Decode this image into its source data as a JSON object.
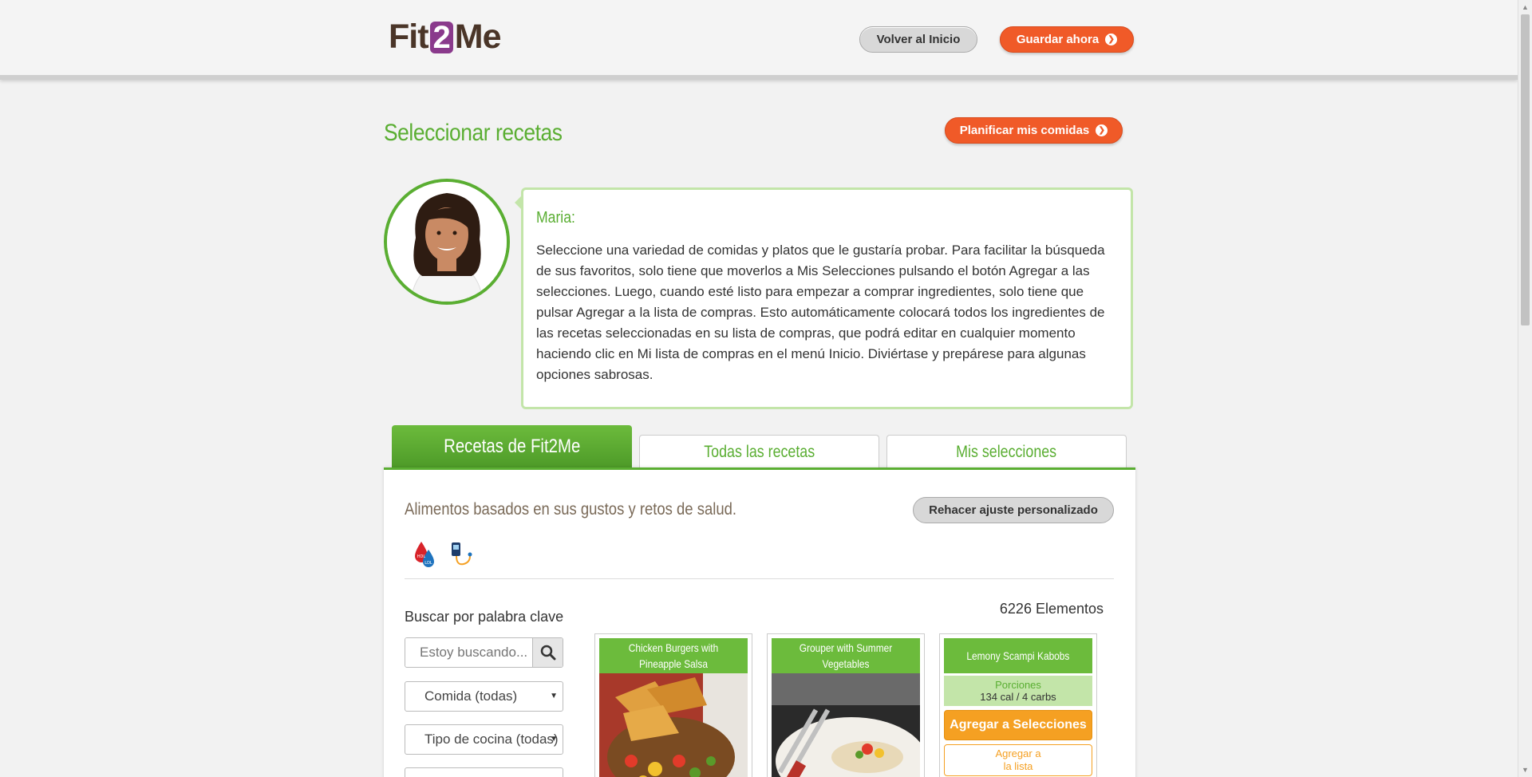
{
  "header": {
    "logo_left": "Fit",
    "logo_mid": "2",
    "logo_right": "Me",
    "back_home": "Volver al Inicio",
    "save_now": "Guardar ahora"
  },
  "page": {
    "title": "Seleccionar recetas",
    "plan_button": "Planificar mis comidas"
  },
  "coach": {
    "name": "Maria:",
    "message": "Seleccione una variedad de comidas y platos que le gustaría probar. Para facilitar la búsqueda de sus favoritos, solo tiene que moverlos a Mis Selecciones pulsando el botón Agregar a las selecciones. Luego, cuando esté listo para empezar a comprar ingredientes, solo tiene que pulsar Agregar a la lista de compras. Esto automáticamente colocará todos los ingredientes de las recetas seleccionadas en su lista de compras, que podrá editar en cualquier momento haciendo clic en Mi lista de compras en el menú Inicio. Diviértase y prepárese para algunas opciones sabrosas."
  },
  "tabs": [
    {
      "label": "Recetas de Fit2Me",
      "active": true
    },
    {
      "label": "Todas las recetas",
      "active": false
    },
    {
      "label": "Mis selecciones",
      "active": false
    }
  ],
  "panel": {
    "subtitle": "Alimentos basados en sus gustos y retos de salud.",
    "redo_button": "Rehacer ajuste personalizado",
    "health_icons": [
      "cholesterol-hdl-ldl-icon",
      "blood-glucose-meter-icon"
    ],
    "search_label": "Buscar por palabra clave",
    "search_placeholder": "Estoy buscando...",
    "filter_meal": "Comida (todas)",
    "filter_cuisine": "Tipo de cocina (todas)",
    "count": "6226 Elementos"
  },
  "cards": [
    {
      "title": "Chicken Burgers with Pineapple Salsa"
    },
    {
      "title": "Grouper with Summer Vegetables"
    },
    {
      "title": "Lemony Scampi Kabobs",
      "portion_label": "Porciones",
      "portion_value": "134 cal / 4 carbs",
      "add_selection": "Agregar a Selecciones",
      "add_list_line1": "Agregar a",
      "add_list_line2": "la lista"
    }
  ],
  "colors": {
    "brand_green": "#5aae32",
    "brand_orange": "#f05a28",
    "card_orange": "#f5a022",
    "logo_purple": "#8a3a8c"
  }
}
